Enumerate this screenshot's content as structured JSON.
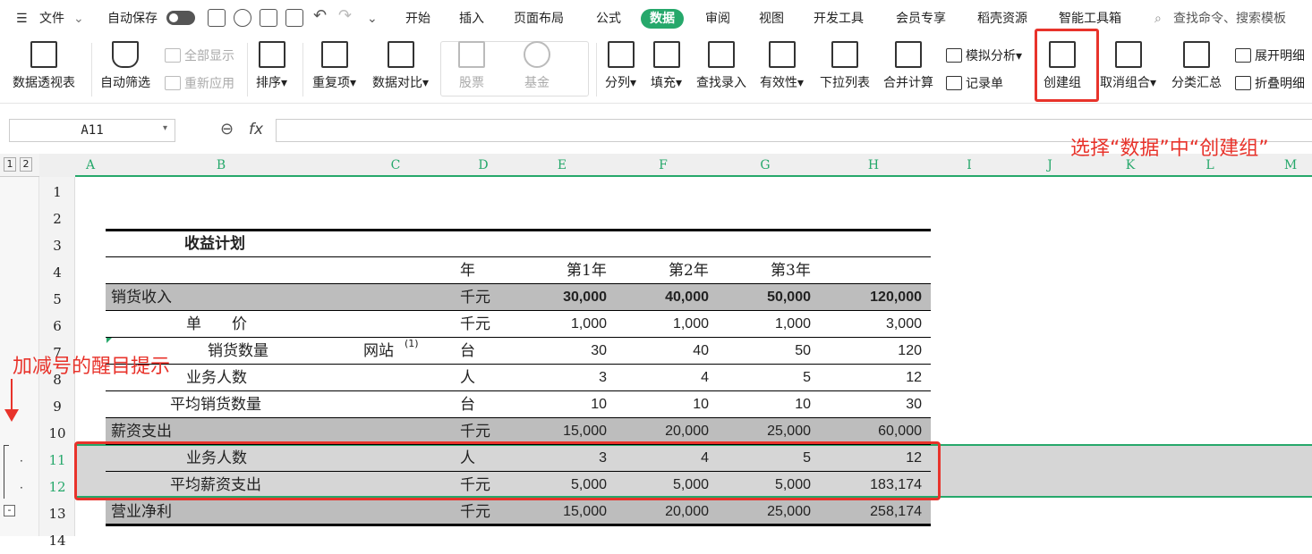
{
  "menubar": {
    "file_label": "文件",
    "autosave_label": "自动保存",
    "tabs": [
      "开始",
      "插入",
      "页面布局",
      "公式",
      "数据",
      "审阅",
      "视图",
      "开发工具",
      "会员专享",
      "稻壳资源",
      "智能工具箱"
    ],
    "active_tab": "数据",
    "search_placeholder": "查找命令、搜索模板"
  },
  "ribbon": {
    "pivot": "数据透视表",
    "autofilter": "自动筛选",
    "show_all": "全部显示",
    "reapply": "重新应用",
    "sort": "排序",
    "dup": "重复项",
    "compare": "数据对比",
    "stock": "股票",
    "fund": "基金",
    "split": "分列",
    "fill": "填充",
    "lookup": "查找录入",
    "validity": "有效性",
    "dropdown": "下拉列表",
    "consolidate": "合并计算",
    "whatif": "模拟分析",
    "record": "记录单",
    "group": "创建组",
    "ungroup": "取消组合",
    "subtotal": "分类汇总",
    "expand": "展开明细",
    "collapse": "折叠明细"
  },
  "formula_bar": {
    "cell_ref": "A11",
    "fx": "fx",
    "formula": ""
  },
  "outline_levels": [
    "1",
    "2"
  ],
  "columns": [
    "A",
    "B",
    "C",
    "D",
    "E",
    "F",
    "G",
    "H",
    "I",
    "J",
    "K",
    "L",
    "M"
  ],
  "rows": [
    "1",
    "2",
    "3",
    "4",
    "5",
    "6",
    "7",
    "8",
    "9",
    "10",
    "11",
    "12",
    "13",
    "14"
  ],
  "sheet": {
    "title": "收益计划",
    "header": {
      "unit": "年",
      "y1": "第1年",
      "y2": "第2年",
      "y3": "第3年"
    },
    "r5": {
      "label": "销货收入",
      "unit": "千元",
      "v": [
        "30,000",
        "40,000",
        "50,000",
        "120,000"
      ]
    },
    "r6": {
      "label": "单　　价",
      "unit": "千元",
      "v": [
        "1,000",
        "1,000",
        "1,000",
        "3,000"
      ]
    },
    "r7": {
      "label": "销货数量",
      "note": "网站",
      "sup": "(1)",
      "unit": "台",
      "v": [
        "30",
        "40",
        "50",
        "120"
      ]
    },
    "r8": {
      "label": "业务人数",
      "unit": "人",
      "v": [
        "3",
        "4",
        "5",
        "12"
      ]
    },
    "r9": {
      "label": "平均销货数量",
      "unit": "台",
      "v": [
        "10",
        "10",
        "10",
        "30"
      ]
    },
    "r10": {
      "label": "薪资支出",
      "unit": "千元",
      "v": [
        "15,000",
        "20,000",
        "25,000",
        "60,000"
      ]
    },
    "r11": {
      "label": "业务人数",
      "unit": "人",
      "v": [
        "3",
        "4",
        "5",
        "12"
      ]
    },
    "r12": {
      "label": "平均薪资支出",
      "unit": "千元",
      "v": [
        "5,000",
        "5,000",
        "5,000",
        "183,174"
      ]
    },
    "r13": {
      "label": "营业净利",
      "unit": "千元",
      "v": [
        "15,000",
        "20,000",
        "25,000",
        "258,174"
      ]
    }
  },
  "annotations": {
    "group_hint": "选择“数据”中“创建组”",
    "outline_hint": "加减号的醒目提示"
  },
  "colors": {
    "accent": "#26a86b",
    "annotation": "#e8332b",
    "shade": "#bdbdbd"
  }
}
